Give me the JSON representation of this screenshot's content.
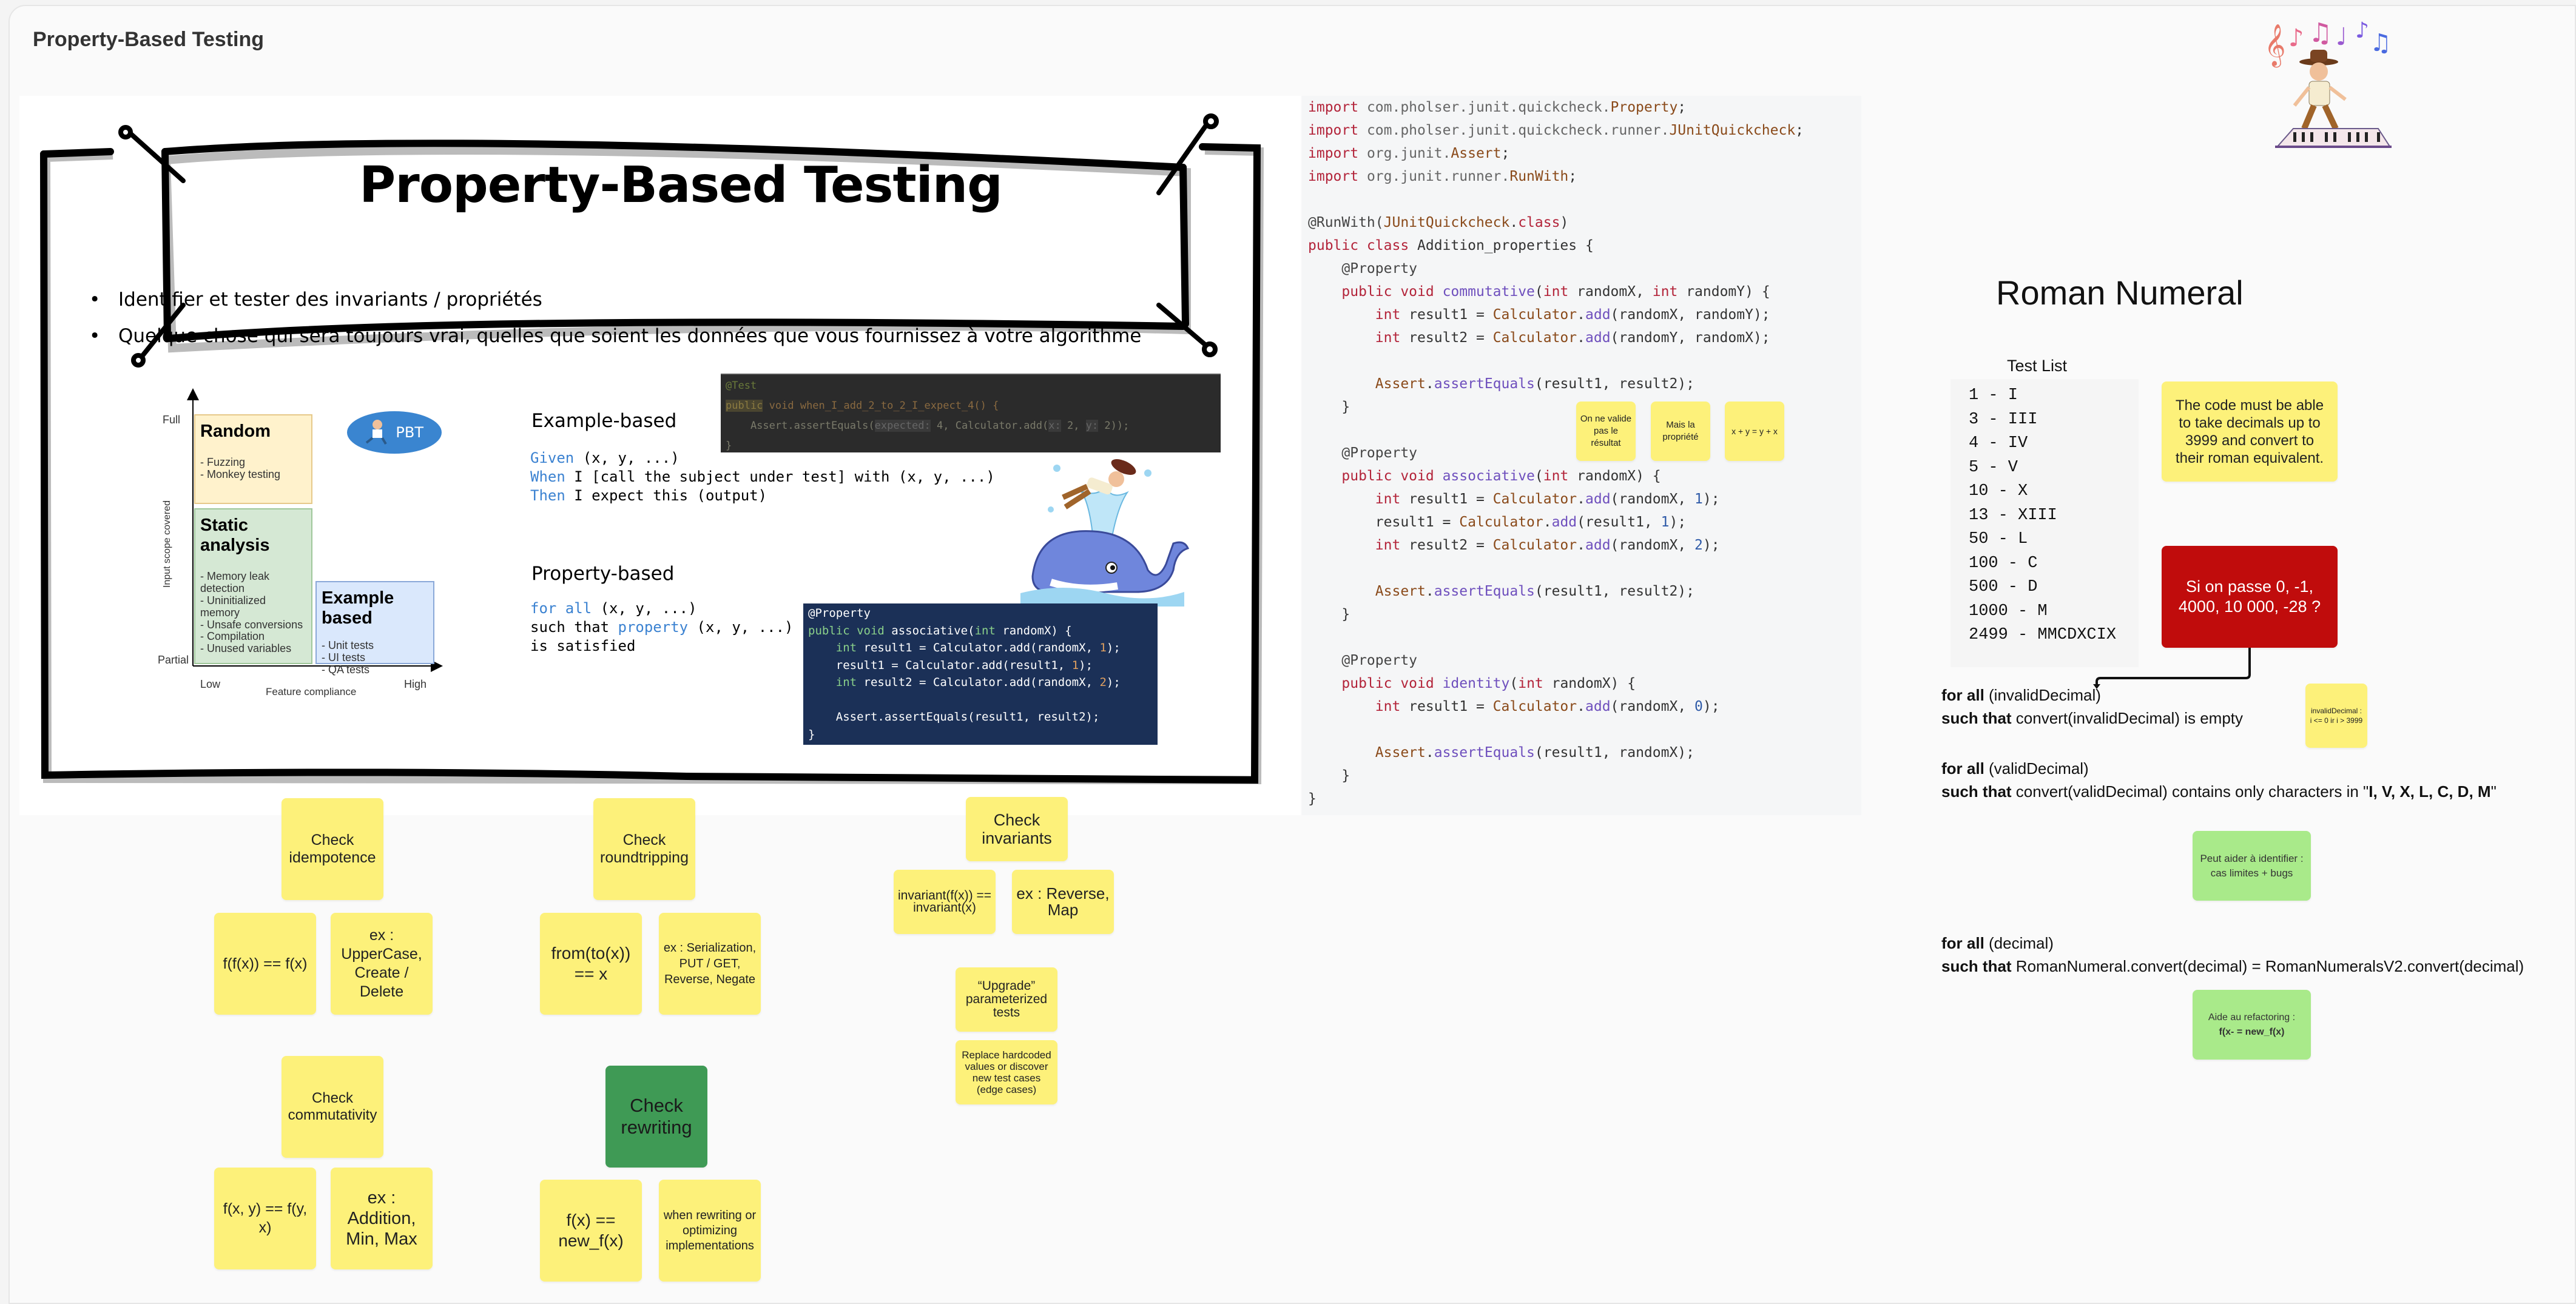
{
  "board": {
    "title": "Property-Based Testing"
  },
  "slide": {
    "title": "Property-Based Testing",
    "bullets": [
      "Identifier et tester des invariants / propriétés",
      "Quelque chose qui sera toujours vrai, quelles que soient les données que vous fournissez à votre algorithme"
    ],
    "quadrant": {
      "y_axis_label": "Input scope covered",
      "y_top": "Full",
      "y_bottom": "Partial",
      "x_axis_label": "Feature compliance",
      "x_left": "Low",
      "x_right": "High",
      "badge": "PBT",
      "boxes": [
        {
          "title": "Random",
          "items": [
            "- Fuzzing",
            "- Monkey testing"
          ]
        },
        {
          "title": "Static analysis",
          "items": [
            "- Memory leak detection",
            "- Uninitialized memory",
            "- Unsafe conversions"
          ],
          "items_low": [
            "- Compilation",
            "- Unused variables"
          ]
        },
        {
          "title": "Example based",
          "items": [
            "- Unit tests",
            "- UI tests",
            "- QA tests"
          ]
        }
      ]
    },
    "example_based": {
      "heading": "Example-based",
      "lines": [
        {
          "kw": "Given",
          "rest": " (x, y, ...)"
        },
        {
          "kw": "When",
          "rest": " I [call the subject under test] with (x, y, ...)"
        },
        {
          "kw": "Then",
          "rest": " I expect this (output)"
        }
      ],
      "code": {
        "line1": "@Test",
        "line2_pub": "public",
        "line2_rest": " void when_I_add_2_to_2_I_expect_4() {",
        "line3_a": "    Assert.assertEquals(",
        "line3_hint1": "expected:",
        "line3_b": " 4, Calculator.add(",
        "line3_hint2": "x:",
        "line3_c": " 2, ",
        "line3_hint3": "y:",
        "line3_d": " 2));",
        "line4": "}"
      }
    },
    "property_based": {
      "heading": "Property-based",
      "line1_kw": "for all",
      "line1_rest": " (x, y, ...)",
      "line2_a": "such that ",
      "line2_kw": "property",
      "line2_rest": " (x, y, ...)",
      "line3": "is satisfied",
      "code": {
        "l1": "@Property",
        "l2_kw": "public void",
        "l2_rest": " associative(",
        "l2_int": "int",
        "l2_end": " randomX) {",
        "l3_int": "    int",
        "l3_a": " result1 = Calculator.add(randomX, ",
        "l3_n": "1",
        "l3_e": ");",
        "l4_a": "    result1 = Calculator.add(result1, ",
        "l4_n": "1",
        "l4_e": ");",
        "l5_int": "    int",
        "l5_a": " result2 = Calculator.add(randomX, ",
        "l5_n": "2",
        "l5_e": ");",
        "l7": "    Assert.assertEquals(result1, result2);",
        "l8": "}"
      }
    }
  },
  "code_panel": {
    "imports": [
      {
        "kw": "import",
        "pkg": " com.pholser.junit.quickcheck.",
        "cls": "Property",
        "end": ";"
      },
      {
        "kw": "import",
        "pkg": " com.pholser.junit.quickcheck.runner.",
        "cls": "JUnitQuickcheck",
        "end": ";"
      },
      {
        "kw": "import",
        "pkg": " org.junit.",
        "cls": "Assert",
        "end": ";"
      },
      {
        "kw": "import",
        "pkg": " org.junit.runner.",
        "cls": "RunWith",
        "end": ";"
      }
    ],
    "runwith_a": "@RunWith(",
    "runwith_cls": "JUnitQuickcheck",
    "runwith_dot": ".",
    "runwith_kw": "class",
    "runwith_end": ")",
    "class_kw": "public class",
    "class_name": " Addition_properties {",
    "annotation": "@Property",
    "methods": [
      {
        "name": "commutative",
        "params_a": "int",
        "params_b": " randomX, ",
        "params_c": "int",
        "params_d": " randomY) {",
        "body": [
          {
            "int": "int",
            "var": " result1 = ",
            "cls": "Calculator",
            "fn": "add",
            "args": "(randomX, randomY);"
          },
          {
            "int": "int",
            "var": " result2 = ",
            "cls": "Calculator",
            "fn": "add",
            "args": "(randomY, randomX);"
          }
        ],
        "assert_args": "(result1, result2);"
      },
      {
        "name": "associative",
        "params_a": "int",
        "params_b": " randomX) {",
        "body": [
          {
            "int": "int",
            "var": " result1 = ",
            "cls": "Calculator",
            "fn": "add",
            "args_a": "(randomX, ",
            "num": "1",
            "args_b": ");"
          },
          {
            "int": "",
            "var": "result1 = ",
            "cls": "Calculator",
            "fn": "add",
            "args_a": "(result1, ",
            "num": "1",
            "args_b": ");"
          },
          {
            "int": "int",
            "var": " result2 = ",
            "cls": "Calculator",
            "fn": "add",
            "args_a": "(randomX, ",
            "num": "2",
            "args_b": ");"
          }
        ],
        "assert_args": "(result1, result2);"
      },
      {
        "name": "identity",
        "params_a": "int",
        "params_b": " randomX) {",
        "body": [
          {
            "int": "int",
            "var": " result1 = ",
            "cls": "Calculator",
            "fn": "add",
            "args_a": "(randomX, ",
            "num": "0",
            "args_b": ");"
          }
        ],
        "assert_args": "(result1, randomX);"
      }
    ],
    "assert_cls": "Assert",
    "assert_fn": "assertEquals",
    "public_void": "public void",
    "close_brace": "}",
    "notes": [
      "On ne valide pas le résultat",
      "Mais la propriété",
      "x + y = y + x"
    ]
  },
  "patterns": {
    "idempotence": {
      "title": "Check idempotence",
      "formula": "f(f(x)) == f(x)",
      "example": "ex : UpperCase, Create / Delete"
    },
    "roundtripping": {
      "title": "Check roundtripping",
      "formula": "from(to(x)) == x",
      "example": "ex : Serialization, PUT / GET, Reverse, Negate"
    },
    "invariants": {
      "title": "Check invariants",
      "formula": "invariant(f(x)) == invariant(x)",
      "example": "ex : Reverse, Map"
    },
    "commutativity": {
      "title": "Check commutativity",
      "formula": "f(x, y) == f(y, x)",
      "example": "ex : Addition, Min, Max"
    },
    "rewriting": {
      "title": "Check rewriting",
      "formula": "f(x) == new_f(x)",
      "example": "when rewriting or optimizing implementations"
    },
    "upgrade": {
      "title": "“Upgrade” parameterized tests",
      "detail": "Replace hardcoded values or discover new test cases (edge cases)"
    }
  },
  "roman": {
    "title": "Roman Numeral",
    "test_list_label": "Test List",
    "test_list": [
      "1 - I",
      "3 - III",
      "4 - IV",
      "5 - V",
      "10 - X",
      "13 - XIII",
      "50 - L",
      "100 - C",
      "500 - D",
      "1000 - M",
      "2499 - MMCDXCIX"
    ],
    "requirement_note": "The code must be able to take decimals up to 3999 and convert to their roman equivalent.",
    "question_note": "Si on passe 0, -1, 4000, 10 000, -28 ?",
    "invalid_note": "invalidDecimal : i <= 0 ir i > 3999",
    "for_all": "for all",
    "such_that": "such that",
    "props": [
      {
        "var": " (invalidDecimal)",
        "cond": " convert(invalidDecimal) is empty"
      },
      {
        "var": " (validDecimal)",
        "cond": " convert(validDecimal) contains only characters in \"",
        "cond_bold": "I, V, X, L, C, D, M",
        "cond_end": "\""
      },
      {
        "var": " (decimal)",
        "cond": " RomanNumeral.convert(decimal) = RomanNumeralsV2.convert(decimal)"
      }
    ],
    "edge_note": "Peut aider à identifier : cas limites + bugs",
    "refactor_note": "Aide au refactoring :",
    "refactor_formula": "f(x- = new_f(x)"
  }
}
